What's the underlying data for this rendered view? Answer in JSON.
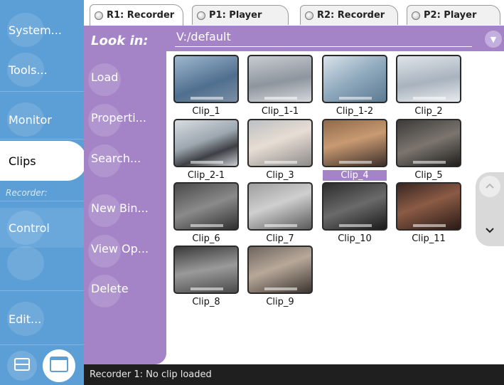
{
  "sidebar": {
    "items": [
      {
        "label": "System..."
      },
      {
        "label": "Tools..."
      },
      {
        "label": "Monitor"
      },
      {
        "label": "Clips"
      },
      {
        "label": "Control"
      },
      {
        "label": ""
      },
      {
        "label": "Edit..."
      }
    ],
    "recorder_label": "Recorder:"
  },
  "tabs": [
    {
      "label": "R1: Recorder"
    },
    {
      "label": "P1: Player"
    },
    {
      "label": "R2: Recorder"
    },
    {
      "label": "P2: Player"
    }
  ],
  "look_in": {
    "label": "Look in:",
    "path": "V:/default"
  },
  "actions": [
    {
      "label": "Load"
    },
    {
      "label": "Properti..."
    },
    {
      "label": "Search..."
    },
    {
      "label": "New Bin..."
    },
    {
      "label": "View Op..."
    },
    {
      "label": "Delete"
    }
  ],
  "clips": [
    {
      "label": "Clip_1"
    },
    {
      "label": "Clip_1-1"
    },
    {
      "label": "Clip_1-2"
    },
    {
      "label": "Clip_2"
    },
    {
      "label": "Clip_2-1"
    },
    {
      "label": "Clip_3"
    },
    {
      "label": "Clip_4",
      "selected": true
    },
    {
      "label": "Clip_5"
    },
    {
      "label": "Clip_6"
    },
    {
      "label": "Clip_7"
    },
    {
      "label": "Clip_10"
    },
    {
      "label": "Clip_11"
    },
    {
      "label": "Clip_8"
    },
    {
      "label": "Clip_9"
    }
  ],
  "status": {
    "text": "Recorder 1: No clip loaded"
  },
  "colors": {
    "sidebar": "#5c9fd6",
    "panel": "#a484c6",
    "selection": "#a484c6",
    "status_bar": "#1f1f1f"
  }
}
